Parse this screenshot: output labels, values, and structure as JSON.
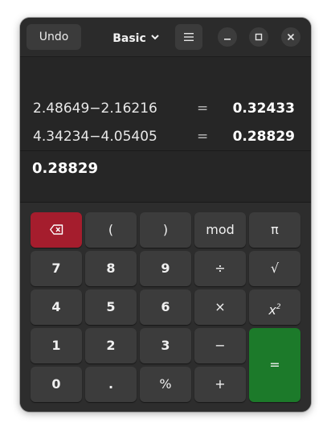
{
  "header": {
    "undo_label": "Undo",
    "mode_label": "Basic",
    "mode_icon": "chevron-down-icon",
    "menu_icon": "hamburger-menu-icon",
    "window_controls": [
      "minimize-icon",
      "maximize-icon",
      "close-icon"
    ]
  },
  "display": {
    "history": [
      {
        "expression": "2.48649−2.16216",
        "equals": "=",
        "result": "0.32433"
      },
      {
        "expression": "4.34234−4.05405",
        "equals": "=",
        "result": "0.28829"
      }
    ],
    "current": "0.28829"
  },
  "keys": {
    "backspace_icon": "backspace-icon",
    "open_paren": "(",
    "close_paren": ")",
    "mod": "mod",
    "pi": "π",
    "k7": "7",
    "k8": "8",
    "k9": "9",
    "divide": "÷",
    "sqrt": "√",
    "k4": "4",
    "k5": "5",
    "k6": "6",
    "multiply": "×",
    "square_base": "x",
    "square_exp": "2",
    "k1": "1",
    "k2": "2",
    "k3": "3",
    "subtract": "−",
    "equals": "=",
    "k0": "0",
    "point": ".",
    "percent": "%",
    "add": "+"
  },
  "colors": {
    "window_bg": "#2d2d2d",
    "display_bg": "#262626",
    "key_bg": "#3c3c3c",
    "destructive": "#a51d2d",
    "suggested": "#1c7a2a"
  }
}
